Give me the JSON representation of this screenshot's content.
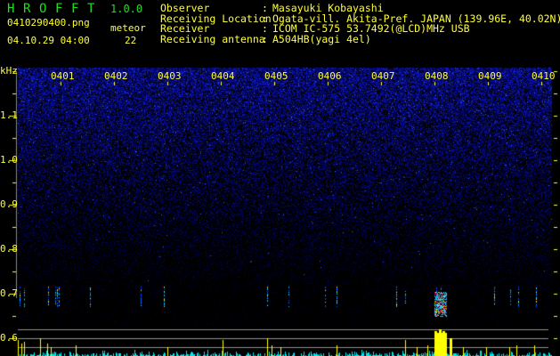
{
  "app": {
    "title_letters": [
      "H",
      "R",
      "O",
      "F",
      "F",
      "T"
    ],
    "version": "1.0.0",
    "filename": "0410290400.png",
    "datetime": "04.10.29 04:00",
    "meteor_label": "meteor",
    "meteor_count": "22"
  },
  "info": [
    {
      "label": "Observer",
      "value": "Masayuki Kobayashi"
    },
    {
      "label": "Receiving Location",
      "value": "Ogata-vill. Akita-Pref. JAPAN (139.96E, 40.02N)"
    },
    {
      "label": "Receiver",
      "value": "ICOM IC-575 53.7492(@LCD)MHz USB"
    },
    {
      "label": "Receiving antenna",
      "value": "A504HB(yagi 4el)"
    }
  ],
  "plot": {
    "y_unit": "kHz",
    "y_ticks": [
      "1.1",
      "1.0",
      "0.9",
      "0.8",
      "0.7",
      "0.6"
    ],
    "time_ticks": [
      "0401",
      "0402",
      "0403",
      "0404",
      "0405",
      "0406",
      "0407",
      "0408",
      "0409",
      "0410"
    ],
    "colors": {
      "text": "#ffff33",
      "title": "#22dd22",
      "noise": "#1a1aa0",
      "bars_low": "#00e5ee",
      "bars_high": "#ffff00",
      "grid": "#909090"
    }
  }
}
